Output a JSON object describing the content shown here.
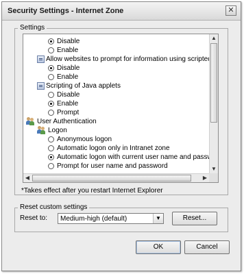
{
  "window": {
    "title": "Security Settings - Internet Zone",
    "close_glyph": "✕"
  },
  "settings_group": {
    "label": "Settings",
    "rows": [
      {
        "kind": "radio",
        "label": "Disable",
        "checked": true
      },
      {
        "kind": "radio",
        "label": "Enable",
        "checked": false
      },
      {
        "kind": "setting",
        "label": "Allow websites to prompt for information using scripted windo",
        "icon": "settings-icon"
      },
      {
        "kind": "radio",
        "label": "Disable",
        "checked": true
      },
      {
        "kind": "radio",
        "label": "Enable",
        "checked": false
      },
      {
        "kind": "setting",
        "label": "Scripting of Java applets",
        "icon": "settings-icon"
      },
      {
        "kind": "radio",
        "label": "Disable",
        "checked": false
      },
      {
        "kind": "radio",
        "label": "Enable",
        "checked": true
      },
      {
        "kind": "radio",
        "label": "Prompt",
        "checked": false
      },
      {
        "kind": "category",
        "label": "User Authentication",
        "icon": "users-icon"
      },
      {
        "kind": "subcategory",
        "label": "Logon",
        "icon": "users-icon"
      },
      {
        "kind": "radio2",
        "label": "Anonymous logon",
        "checked": false
      },
      {
        "kind": "radio2",
        "label": "Automatic logon only in Intranet zone",
        "checked": false
      },
      {
        "kind": "radio2",
        "label": "Automatic logon with current user name and password",
        "checked": true
      },
      {
        "kind": "radio2",
        "label": "Prompt for user name and password",
        "checked": false
      }
    ],
    "note": "*Takes effect after you restart Internet Explorer"
  },
  "reset_group": {
    "label": "Reset custom settings",
    "reset_to_label": "Reset to:",
    "selected": "Medium-high (default)",
    "reset_button": "Reset..."
  },
  "footer": {
    "ok_label": "OK",
    "cancel_label": "Cancel"
  },
  "scroll_glyphs": {
    "up": "▲",
    "down": "▼",
    "left": "◀",
    "right": "▶"
  }
}
